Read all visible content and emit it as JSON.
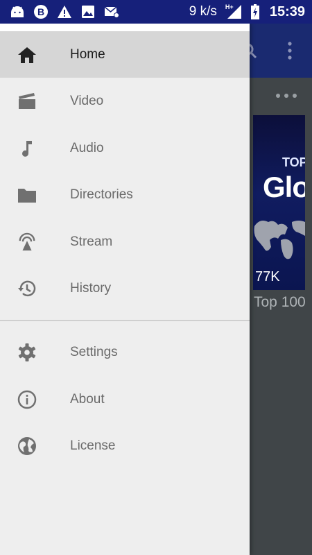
{
  "status_bar": {
    "speed": "9 k/s",
    "network": "H+",
    "time": "15:39",
    "icons": [
      "android-icon",
      "b-circle-icon",
      "warning-icon",
      "image-icon",
      "mail-icon",
      "signal-icon",
      "battery-charging-icon"
    ]
  },
  "background": {
    "thumbnail_top": "TOP",
    "thumbnail_big": "Glo",
    "thumbnail_views": "77K",
    "card_title": "Top 100"
  },
  "drawer": {
    "primary": [
      {
        "label": "Home",
        "icon": "home-icon",
        "active": true
      },
      {
        "label": "Video",
        "icon": "video-icon"
      },
      {
        "label": "Audio",
        "icon": "music-note-icon"
      },
      {
        "label": "Directories",
        "icon": "folder-icon"
      },
      {
        "label": "Stream",
        "icon": "stream-icon"
      },
      {
        "label": "History",
        "icon": "history-icon"
      }
    ],
    "secondary": [
      {
        "label": "Settings",
        "icon": "gear-icon"
      },
      {
        "label": "About",
        "icon": "info-icon"
      },
      {
        "label": "License",
        "icon": "globe-icon"
      }
    ]
  },
  "colors": {
    "status_bar": "#16207a",
    "toolbar": "#1a2a70",
    "drawer_bg": "#eeeeee",
    "active_item": "#d6d6d6",
    "icon_gray": "#707070"
  }
}
